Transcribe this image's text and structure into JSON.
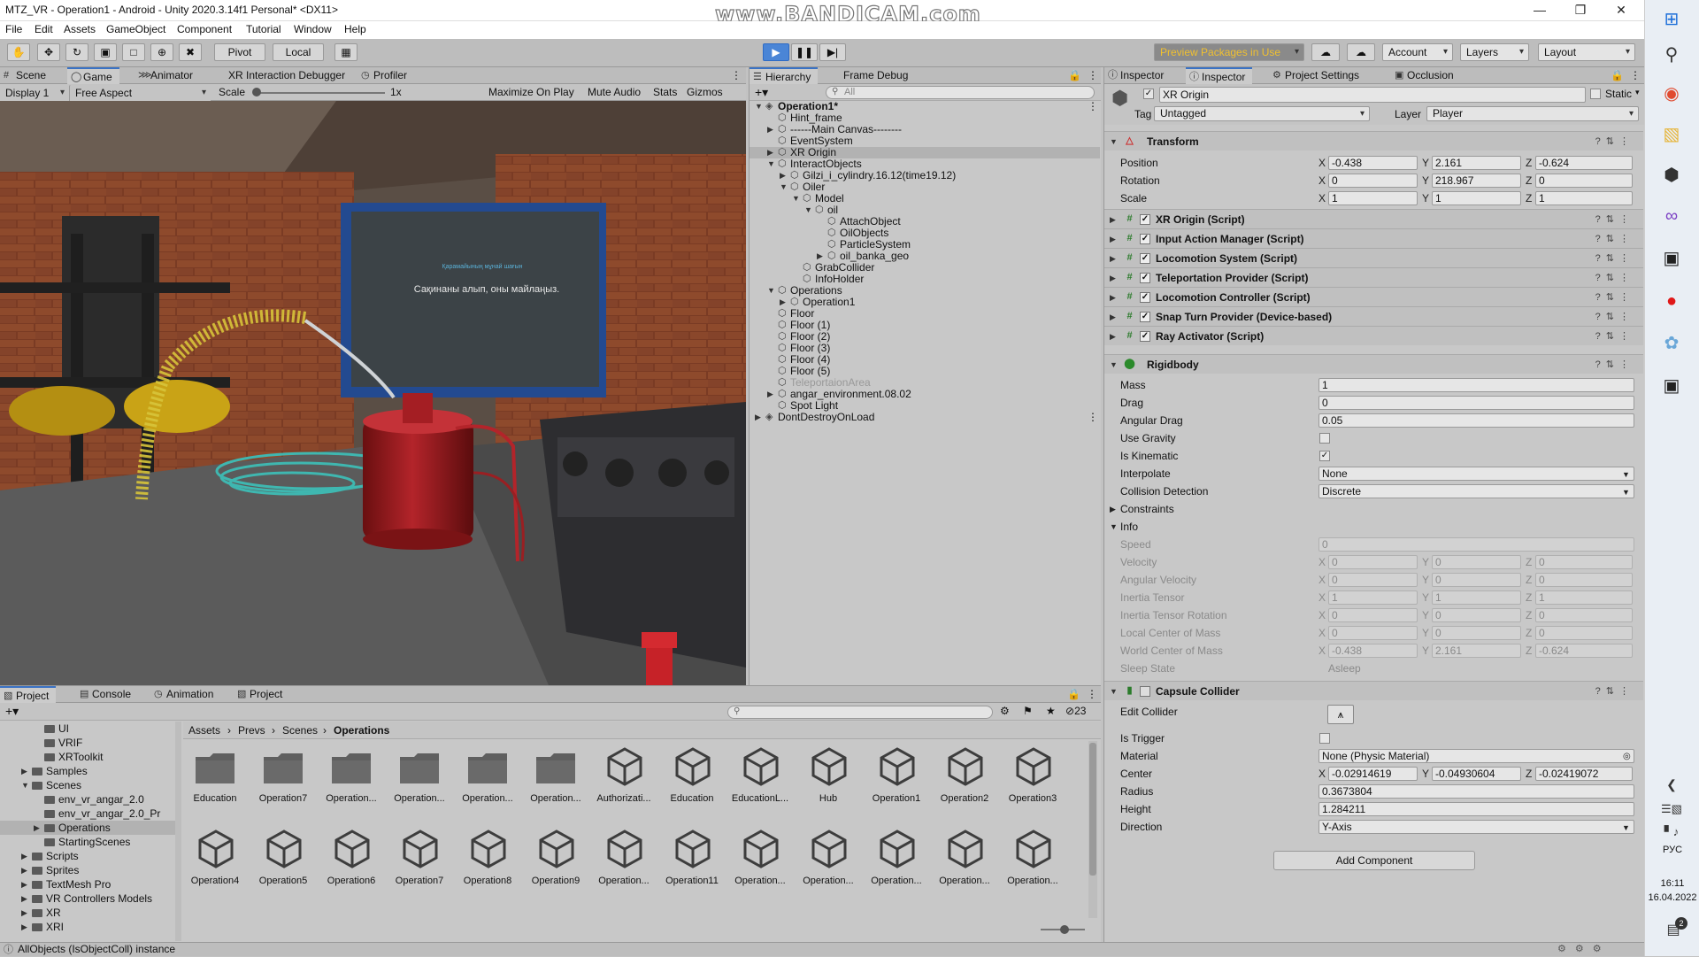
{
  "window": {
    "title": "MTZ_VR - Operation1 - Android - Unity 2020.3.14f1 Personal* <DX11>",
    "watermark": "www.BANDICAM.com"
  },
  "menu": [
    "File",
    "Edit",
    "Assets",
    "GameObject",
    "Component",
    "Tutorial",
    "Window",
    "Help"
  ],
  "toolbar": {
    "pivot": "Pivot",
    "local": "Local",
    "preview_packages": "Preview Packages in Use",
    "account": "Account",
    "layers": "Layers",
    "layout": "Layout"
  },
  "game_tabs": [
    "Scene",
    "Game",
    "Animator",
    "XR Interaction Debugger",
    "Profiler"
  ],
  "game_bar": {
    "display": "Display 1",
    "aspect": "Free Aspect",
    "scale_label": "Scale",
    "scale_value": "1x",
    "maximize": "Maximize On Play",
    "mute": "Mute Audio",
    "stats": "Stats",
    "gizmos": "Gizmos"
  },
  "game_scene": {
    "screen_line1": "Қарамайының мұнай шағын",
    "screen_line2": "Сақинаны алып, оны майлаңыз."
  },
  "hierarchy": {
    "tabs": [
      "Hierarchy",
      "Frame Debug"
    ],
    "search_placeholder": "All",
    "items": [
      {
        "label": "Operation1*",
        "depth": 0,
        "arrow": "open",
        "scene": true,
        "bold": true
      },
      {
        "label": "Hint_frame",
        "depth": 1,
        "arrow": "none"
      },
      {
        "label": "------Main Canvas--------",
        "depth": 1,
        "arrow": "closed"
      },
      {
        "label": "EventSystem",
        "depth": 1,
        "arrow": "none"
      },
      {
        "label": "XR Origin",
        "depth": 1,
        "arrow": "closed",
        "selected": true
      },
      {
        "label": "InteractObjects",
        "depth": 1,
        "arrow": "open"
      },
      {
        "label": "Gilzi_i_cylindry.16.12(time19.12)",
        "depth": 2,
        "arrow": "closed"
      },
      {
        "label": "Oiler",
        "depth": 2,
        "arrow": "open"
      },
      {
        "label": "Model",
        "depth": 3,
        "arrow": "open"
      },
      {
        "label": "oil",
        "depth": 4,
        "arrow": "open"
      },
      {
        "label": "AttachObject",
        "depth": 5,
        "arrow": "none"
      },
      {
        "label": "OilObjects",
        "depth": 5,
        "arrow": "none"
      },
      {
        "label": "ParticleSystem",
        "depth": 5,
        "arrow": "none"
      },
      {
        "label": "oil_banka_geo",
        "depth": 5,
        "arrow": "closed"
      },
      {
        "label": "GrabCollider",
        "depth": 3,
        "arrow": "none"
      },
      {
        "label": "InfoHolder",
        "depth": 3,
        "arrow": "none"
      },
      {
        "label": "Operations",
        "depth": 1,
        "arrow": "open"
      },
      {
        "label": "Operation1",
        "depth": 2,
        "arrow": "closed"
      },
      {
        "label": "Floor",
        "depth": 1,
        "arrow": "none"
      },
      {
        "label": "Floor (1)",
        "depth": 1,
        "arrow": "none"
      },
      {
        "label": "Floor (2)",
        "depth": 1,
        "arrow": "none"
      },
      {
        "label": "Floor (3)",
        "depth": 1,
        "arrow": "none"
      },
      {
        "label": "Floor (4)",
        "depth": 1,
        "arrow": "none"
      },
      {
        "label": "Floor (5)",
        "depth": 1,
        "arrow": "none"
      },
      {
        "label": "TeleportaionArea",
        "depth": 1,
        "arrow": "none",
        "disabled": true
      },
      {
        "label": "angar_environment.08.02",
        "depth": 1,
        "arrow": "closed"
      },
      {
        "label": "Spot Light",
        "depth": 1,
        "arrow": "none"
      },
      {
        "label": "DontDestroyOnLoad",
        "depth": 0,
        "arrow": "closed",
        "scene": true
      }
    ]
  },
  "inspector": {
    "tabs": [
      "Inspector",
      "Inspector",
      "Project Settings",
      "Occlusion"
    ],
    "object_name": "XR Origin",
    "static_label": "Static",
    "tag_label": "Tag",
    "tag_value": "Untagged",
    "layer_label": "Layer",
    "layer_value": "Player",
    "transform": {
      "title": "Transform",
      "position": {
        "label": "Position",
        "x": "-0.438",
        "y": "2.161",
        "z": "-0.624"
      },
      "rotation": {
        "label": "Rotation",
        "x": "0",
        "y": "218.967",
        "z": "0"
      },
      "scale": {
        "label": "Scale",
        "x": "1",
        "y": "1",
        "z": "1"
      }
    },
    "scripts": [
      "XR Origin (Script)",
      "Input Action Manager (Script)",
      "Locomotion System (Script)",
      "Teleportation Provider (Script)",
      "Locomotion Controller (Script)",
      "Snap Turn Provider (Device-based)",
      "Ray Activator (Script)"
    ],
    "rigidbody": {
      "title": "Rigidbody",
      "mass": {
        "label": "Mass",
        "value": "1"
      },
      "drag": {
        "label": "Drag",
        "value": "0"
      },
      "angular_drag": {
        "label": "Angular Drag",
        "value": "0.05"
      },
      "use_gravity": {
        "label": "Use Gravity",
        "checked": false
      },
      "is_kinematic": {
        "label": "Is Kinematic",
        "checked": true
      },
      "interpolate": {
        "label": "Interpolate",
        "value": "None"
      },
      "collision_detection": {
        "label": "Collision Detection",
        "value": "Discrete"
      },
      "constraints": "Constraints",
      "info": "Info",
      "speed": {
        "label": "Speed",
        "value": "0"
      },
      "velocity": {
        "label": "Velocity",
        "x": "0",
        "y": "0",
        "z": "0"
      },
      "angular_velocity": {
        "label": "Angular Velocity",
        "x": "0",
        "y": "0",
        "z": "0"
      },
      "inertia_tensor": {
        "label": "Inertia Tensor",
        "x": "1",
        "y": "1",
        "z": "1"
      },
      "inertia_tensor_rotation": {
        "label": "Inertia Tensor Rotation",
        "x": "0",
        "y": "0",
        "z": "0"
      },
      "local_center": {
        "label": "Local Center of Mass",
        "x": "0",
        "y": "0",
        "z": "0"
      },
      "world_center": {
        "label": "World Center of Mass",
        "x": "-0.438",
        "y": "2.161",
        "z": "-0.624"
      },
      "sleep_state": {
        "label": "Sleep State",
        "value": "Asleep"
      }
    },
    "capsule": {
      "title": "Capsule Collider",
      "edit_collider": "Edit Collider",
      "is_trigger": {
        "label": "Is Trigger",
        "checked": false
      },
      "material": {
        "label": "Material",
        "value": "None (Physic Material)"
      },
      "center": {
        "label": "Center",
        "x": "-0.02914619",
        "y": "-0.04930604",
        "z": "-0.02419072"
      },
      "radius": {
        "label": "Radius",
        "value": "0.3673804"
      },
      "height": {
        "label": "Height",
        "value": "1.284211"
      },
      "direction": {
        "label": "Direction",
        "value": "Y-Axis"
      }
    },
    "add_component": "Add Component"
  },
  "project": {
    "tabs": [
      "Project",
      "Console",
      "Animation",
      "Project"
    ],
    "hidden_count": "23",
    "tree": [
      {
        "label": "UI",
        "depth": 3,
        "arrow": "none"
      },
      {
        "label": "VRIF",
        "depth": 3,
        "arrow": "none"
      },
      {
        "label": "XRToolkit",
        "depth": 3,
        "arrow": "none"
      },
      {
        "label": "Samples",
        "depth": 2,
        "arrow": "closed"
      },
      {
        "label": "Scenes",
        "depth": 2,
        "arrow": "open"
      },
      {
        "label": "env_vr_angar_2.0",
        "depth": 3,
        "arrow": "none"
      },
      {
        "label": "env_vr_angar_2.0_Pr",
        "depth": 3,
        "arrow": "none"
      },
      {
        "label": "Operations",
        "depth": 3,
        "arrow": "closed",
        "selected": true
      },
      {
        "label": "StartingScenes",
        "depth": 3,
        "arrow": "none"
      },
      {
        "label": "Scripts",
        "depth": 2,
        "arrow": "closed"
      },
      {
        "label": "Sprites",
        "depth": 2,
        "arrow": "closed"
      },
      {
        "label": "TextMesh Pro",
        "depth": 2,
        "arrow": "closed"
      },
      {
        "label": "VR Controllers Models",
        "depth": 2,
        "arrow": "closed"
      },
      {
        "label": "XR",
        "depth": 2,
        "arrow": "closed"
      },
      {
        "label": "XRI",
        "depth": 2,
        "arrow": "closed"
      }
    ],
    "breadcrumb": [
      "Assets",
      "Prevs",
      "Scenes",
      "Operations"
    ],
    "assets_row1": [
      {
        "name": "Education",
        "kind": "folder"
      },
      {
        "name": "Operation7",
        "kind": "folder"
      },
      {
        "name": "Operation...",
        "kind": "folder"
      },
      {
        "name": "Operation...",
        "kind": "folder"
      },
      {
        "name": "Operation...",
        "kind": "folder"
      },
      {
        "name": "Operation...",
        "kind": "folder"
      },
      {
        "name": "Authorizati...",
        "kind": "scene"
      },
      {
        "name": "Education",
        "kind": "scene"
      },
      {
        "name": "EducationL...",
        "kind": "scene"
      },
      {
        "name": "Hub",
        "kind": "scene"
      },
      {
        "name": "Operation1",
        "kind": "scene"
      },
      {
        "name": "Operation2",
        "kind": "scene"
      },
      {
        "name": "Operation3",
        "kind": "scene"
      }
    ],
    "assets_row2": [
      {
        "name": "Operation4",
        "kind": "scene"
      },
      {
        "name": "Operation5",
        "kind": "scene"
      },
      {
        "name": "Operation6",
        "kind": "scene"
      },
      {
        "name": "Operation7",
        "kind": "scene"
      },
      {
        "name": "Operation8",
        "kind": "scene"
      },
      {
        "name": "Operation9",
        "kind": "scene"
      },
      {
        "name": "Operation...",
        "kind": "scene"
      },
      {
        "name": "Operation11",
        "kind": "scene"
      },
      {
        "name": "Operation...",
        "kind": "scene"
      },
      {
        "name": "Operation...",
        "kind": "scene"
      },
      {
        "name": "Operation...",
        "kind": "scene"
      },
      {
        "name": "Operation...",
        "kind": "scene"
      },
      {
        "name": "Operation...",
        "kind": "scene"
      }
    ]
  },
  "status": {
    "message": "AllObjects (IsObjectColl) instance"
  },
  "taskbar": {
    "lang": "РУС",
    "time": "16:11",
    "date": "16.04.2022",
    "notif": "2"
  },
  "colors": {
    "accent": "#3a72c4",
    "editor_bg": "#c8c8c8",
    "play_blue": "#2f6bc4",
    "preview_yellow": "#f0c030"
  }
}
